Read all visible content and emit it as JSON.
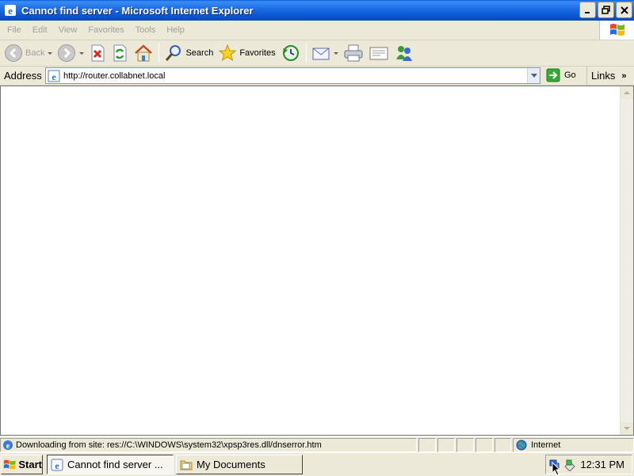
{
  "window": {
    "title": "Cannot find server - Microsoft Internet Explorer"
  },
  "menu": {
    "items": [
      "File",
      "Edit",
      "View",
      "Favorites",
      "Tools",
      "Help"
    ]
  },
  "toolbar": {
    "back_label": "Back",
    "search_label": "Search",
    "favorites_label": "Favorites"
  },
  "address": {
    "label": "Address",
    "url": "http://router.collabnet.local",
    "go_label": "Go",
    "links_label": "Links"
  },
  "status": {
    "text": "Downloading from site: res://C:\\WINDOWS\\system32\\xpsp3res.dll/dnserror.htm",
    "zone": "Internet"
  },
  "taskbar": {
    "start_label": "Start",
    "tasks": [
      {
        "label": "Cannot find server ..."
      },
      {
        "label": "My Documents"
      }
    ],
    "clock": "12:31 PM"
  },
  "colors": {
    "titlebar": "#0a55d0",
    "chrome": "#ece9d8",
    "content_bg": "#ffffff"
  },
  "icons": {
    "title": "ie-icon",
    "back": "back-arrow-icon",
    "forward": "forward-arrow-icon",
    "stop": "stop-icon",
    "refresh": "refresh-icon",
    "home": "home-icon",
    "search": "search-icon",
    "favorites": "favorites-star-icon",
    "history": "history-icon",
    "mail": "mail-icon",
    "print": "print-icon",
    "edit": "edit-icon",
    "messenger": "messenger-icon",
    "go": "go-arrow-icon",
    "zone": "globe-icon"
  }
}
